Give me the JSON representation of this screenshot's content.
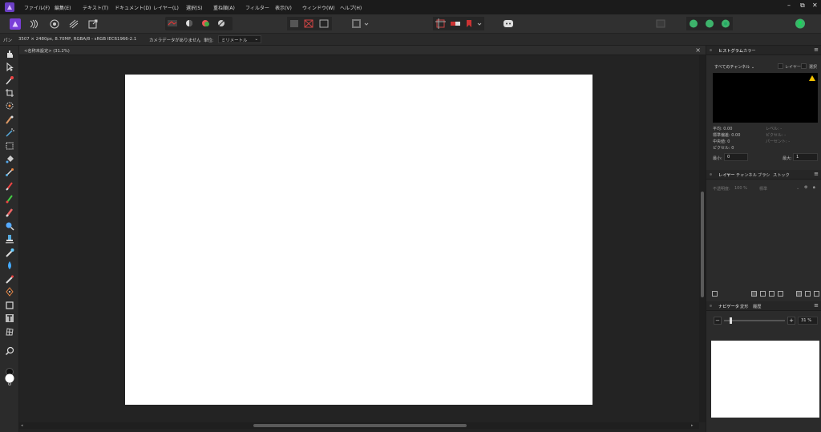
{
  "menubar": {
    "items": [
      "ファイル(F)",
      "編集(E)",
      "テキスト(T)",
      "ドキュメント(D)",
      "レイヤー(L)",
      "選択(S)",
      "重ね順(A)",
      "フィルター",
      "表示(V)",
      "ウィンドウ(W)",
      "ヘルプ(H)"
    ],
    "window_controls": [
      "–",
      "⧉",
      "✕"
    ]
  },
  "context": {
    "tool_name": "パン",
    "doc_info": "3507 × 2480px, 8.70MP, RGBA/8 - sRGB IEC61966-2.1",
    "camera_info": "カメラデータがありません",
    "unit_label": "単位:",
    "unit_value": "ミリメートル"
  },
  "document": {
    "tab_label": "<名称未設定> (31.2%)"
  },
  "histogram_panel": {
    "tabs": [
      "ヒストグラム",
      "カラー"
    ],
    "channel": "すべてのチャンネル",
    "layer_label": "レイヤー",
    "select_label": "選択",
    "stats_left": [
      "平均: 0.00",
      "標準偏差: 0.00",
      "中央値: 0",
      "ピクセル: 0"
    ],
    "stats_right": [
      "レベル: -",
      "ピクセル: -",
      "パーセント: -"
    ],
    "min_label": "最小:",
    "min_value": "0",
    "max_label": "最大:",
    "max_value": "1"
  },
  "layers_panel": {
    "tabs": [
      "レイヤー",
      "チャンネル",
      "ブラシ",
      "ストック"
    ],
    "opacity_label": "不透明度:",
    "opacity_value": "100 %",
    "blend_mode": "標準"
  },
  "navigator_panel": {
    "tabs": [
      "ナビゲータ",
      "変形",
      "履歴"
    ],
    "zoom_value": "31 %",
    "zoom_level": 0.31
  },
  "colors": {
    "accent": "#8a4fd6",
    "canvas": "#ffffff",
    "warning": "#f2c200"
  }
}
